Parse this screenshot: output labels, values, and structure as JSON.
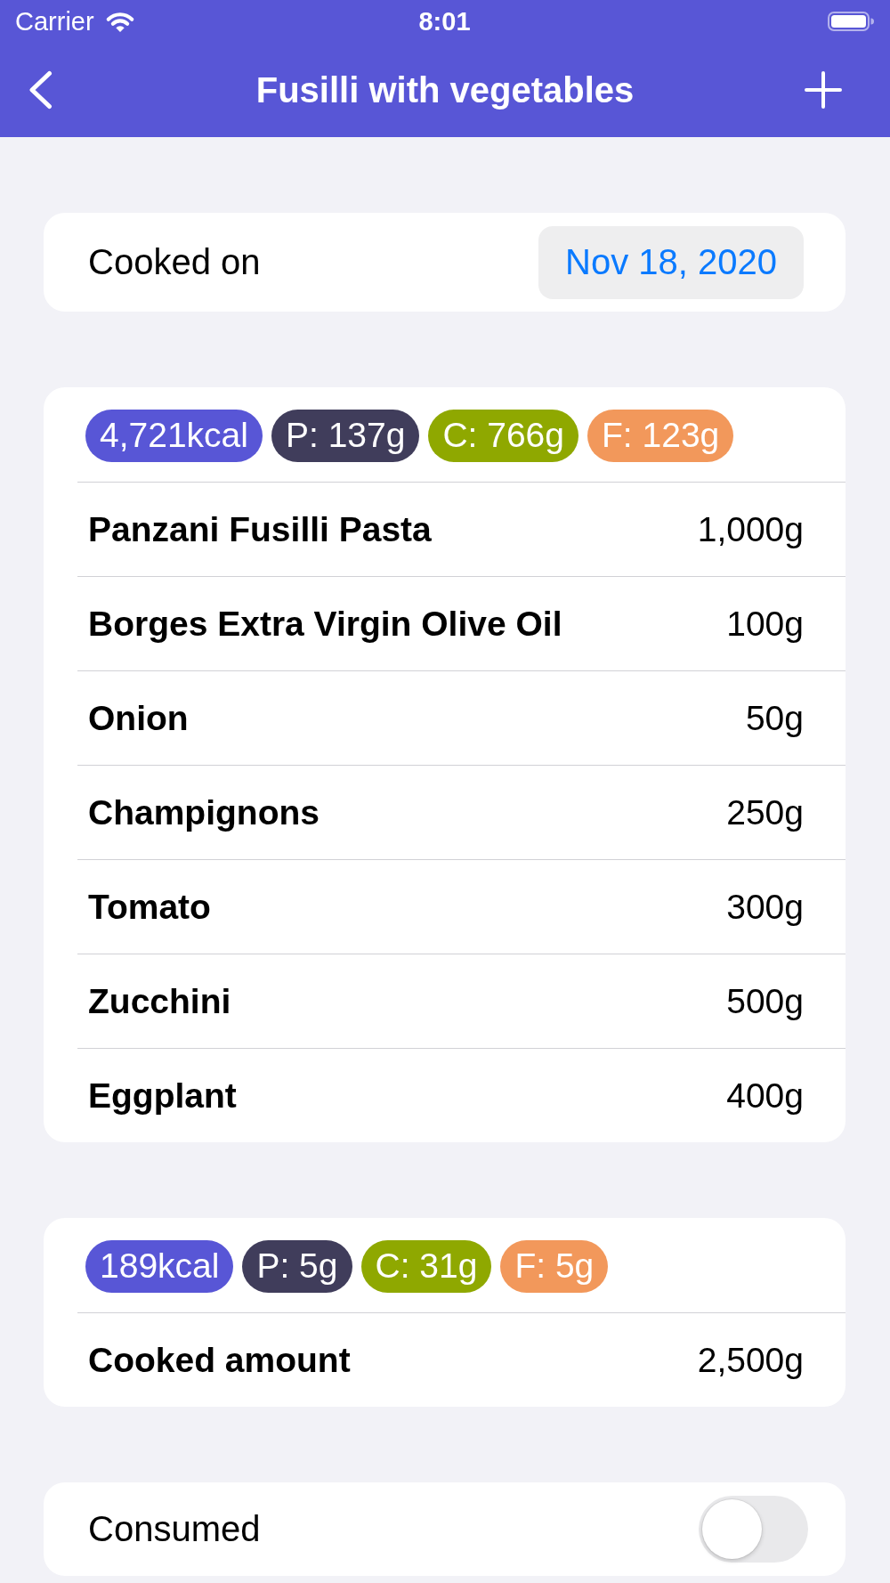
{
  "status_bar": {
    "carrier": "Carrier",
    "time": "8:01"
  },
  "nav_bar": {
    "title": "Fusilli with vegetables"
  },
  "cooked_on": {
    "label": "Cooked on",
    "date": "Nov 18, 2020"
  },
  "ingredients": {
    "macros": [
      {
        "text": "4,721kcal",
        "color": "#5856d6"
      },
      {
        "text": "P: 137g",
        "color": "#403d5b"
      },
      {
        "text": "C: 766g",
        "color": "#8fa800"
      },
      {
        "text": "F: 123g",
        "color": "#f2985b"
      }
    ],
    "rows": [
      {
        "name": "Panzani Fusilli Pasta",
        "amount": "1,000g"
      },
      {
        "name": "Borges Extra Virgin Olive Oil",
        "amount": "100g"
      },
      {
        "name": "Onion",
        "amount": "50g"
      },
      {
        "name": "Champignons",
        "amount": "250g"
      },
      {
        "name": "Tomato",
        "amount": "300g"
      },
      {
        "name": "Zucchini",
        "amount": "500g"
      },
      {
        "name": "Eggplant",
        "amount": "400g"
      }
    ]
  },
  "cooked": {
    "macros": [
      {
        "text": "189kcal",
        "color": "#5856d6"
      },
      {
        "text": "P: 5g",
        "color": "#403d5b"
      },
      {
        "text": "C: 31g",
        "color": "#8fa800"
      },
      {
        "text": "F: 5g",
        "color": "#f2985b"
      }
    ],
    "label": "Cooked amount",
    "amount": "2,500g"
  },
  "consumed": {
    "label": "Consumed",
    "on": false
  }
}
